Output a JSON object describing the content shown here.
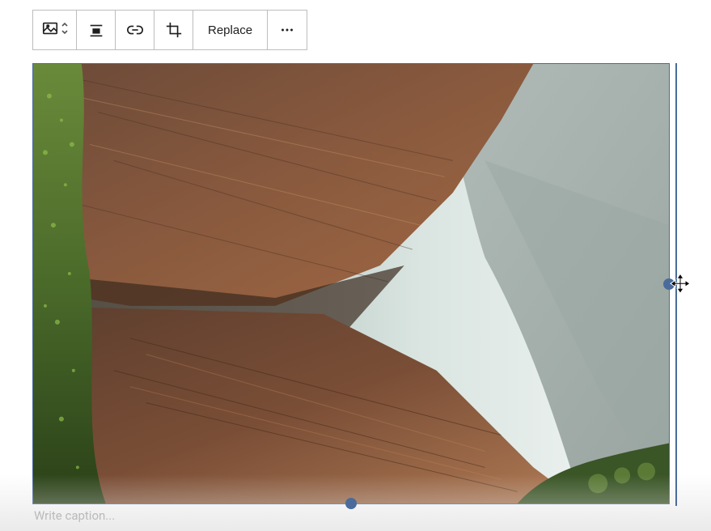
{
  "toolbar": {
    "block_type_icon": "image-icon",
    "transform_icon": "chevron-updown-icon",
    "align_icon": "align-center-icon",
    "link_icon": "link-icon",
    "crop_icon": "crop-icon",
    "replace_label": "Replace",
    "more_icon": "more-horizontal-icon"
  },
  "caption": {
    "placeholder": "Write caption...",
    "value": ""
  }
}
